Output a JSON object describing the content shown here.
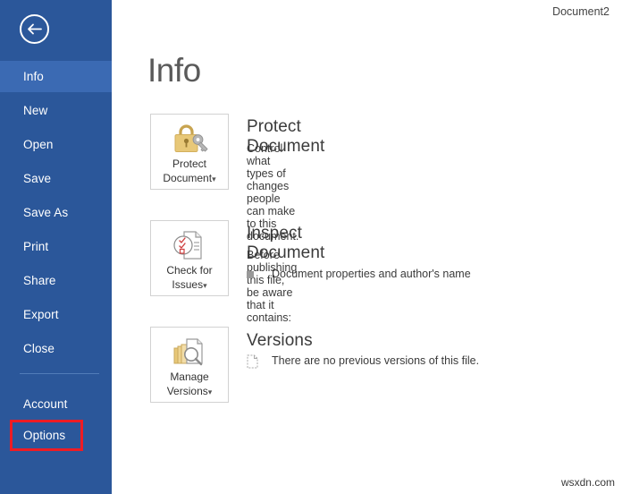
{
  "window": {
    "document_title": "Document2",
    "watermark": "wsxdn.com",
    "accent_color": "#2b579a",
    "selected_nav_color": "#3b6ab3",
    "highlight_box_color": "#ee1c24"
  },
  "sidebar": {
    "back_button": {
      "icon": "back-arrow-icon",
      "label": "Back"
    },
    "items": [
      {
        "label": "Info",
        "selected": true,
        "highlighted": false
      },
      {
        "label": "New",
        "selected": false,
        "highlighted": false
      },
      {
        "label": "Open",
        "selected": false,
        "highlighted": false
      },
      {
        "label": "Save",
        "selected": false,
        "highlighted": false
      },
      {
        "label": "Save As",
        "selected": false,
        "highlighted": false
      },
      {
        "label": "Print",
        "selected": false,
        "highlighted": false
      },
      {
        "label": "Share",
        "selected": false,
        "highlighted": false
      },
      {
        "label": "Export",
        "selected": false,
        "highlighted": false
      },
      {
        "label": "Close",
        "selected": false,
        "highlighted": false
      },
      {
        "label": "Account",
        "selected": false,
        "highlighted": false
      },
      {
        "label": "Options",
        "selected": false,
        "highlighted": true
      }
    ]
  },
  "main": {
    "page_title": "Info",
    "sections": [
      {
        "id": "protect-document",
        "tile_label_line1": "Protect",
        "tile_label_line2": "Document",
        "tile_caret": "▾",
        "tile_icon": "padlock-key-icon",
        "title": "Protect Document",
        "description": "Control what types of changes people can make to this document.",
        "bullets": []
      },
      {
        "id": "inspect-document",
        "tile_label_line1": "Check for",
        "tile_label_line2": "Issues",
        "tile_caret": "▾",
        "tile_icon": "document-inspect-icon",
        "title": "Inspect Document",
        "description": "Before publishing this file, be aware that it contains:",
        "bullets": [
          {
            "icon": "square-bullet-icon",
            "text": "Document properties and author's name"
          }
        ]
      },
      {
        "id": "versions",
        "tile_label_line1": "Manage",
        "tile_label_line2": "Versions",
        "tile_caret": "▾",
        "tile_icon": "document-stack-magnifier-icon",
        "title": "Versions",
        "description": "",
        "bullets": [
          {
            "icon": "dashed-document-icon",
            "text": "There are no previous versions of this file."
          }
        ]
      }
    ]
  }
}
